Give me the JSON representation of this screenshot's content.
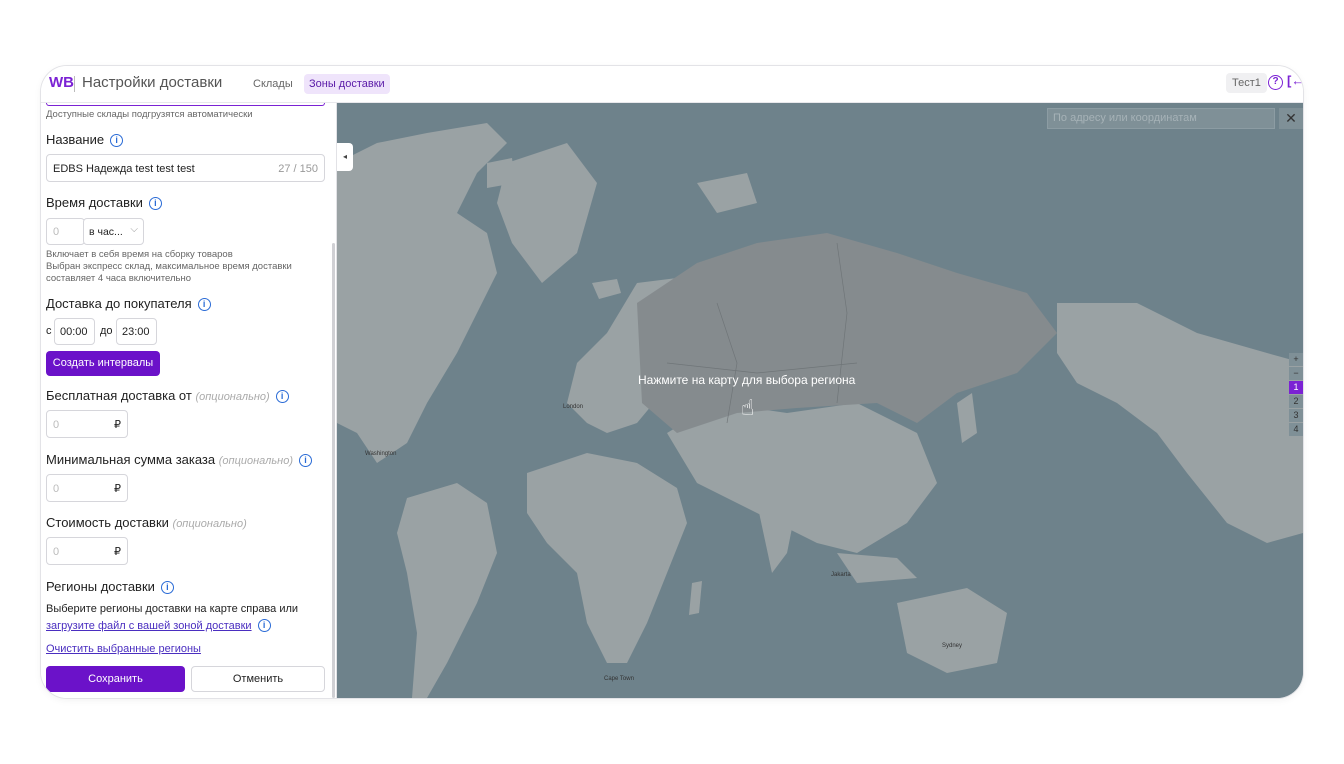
{
  "header": {
    "logo": "WB",
    "title": "Настройки доставки",
    "tabs": [
      {
        "label": "Склады",
        "active": false
      },
      {
        "label": "Зоны доставки",
        "active": true
      }
    ],
    "user": "Тест1",
    "help_icon": "?",
    "logout_icon": "[←"
  },
  "sidebar": {
    "warehouses_hint": "Доступные склады подгрузятся автоматически",
    "name_label": "Название",
    "name_value": "EDBS Надежда test test test",
    "name_counter": "27 / 150",
    "delivery_time_label": "Время доставки",
    "delivery_time_placeholder": "0",
    "delivery_time_unit": "в час...",
    "delivery_time_hint_1": "Включает в себя время на сборку товаров",
    "delivery_time_hint_2": "Выбран экспресс склад, максимальное время доставки",
    "delivery_time_hint_3": "составляет 4 часа включительно",
    "to_customer_label": "Доставка до покупателя",
    "from_prefix": "с",
    "from_value": "00:00",
    "to_prefix": "до",
    "to_value": "23:00",
    "create_intervals_button": "Создать интервалы",
    "free_delivery_label": "Бесплатная доставка от",
    "optional": "(опционально)",
    "min_order_label": "Минимальная сумма заказа",
    "delivery_cost_label": "Стоимость доставки",
    "money_placeholder": "0",
    "currency": "₽",
    "regions_label": "Регионы доставки",
    "regions_text": "Выберите регионы доставки на карте справа или",
    "upload_link": "загрузите файл с вашей зоной доставки",
    "clear_link": "Очистить выбранные регионы",
    "save_button": "Сохранить",
    "cancel_button": "Отменить"
  },
  "map": {
    "search_placeholder": "По адресу или координатам",
    "close": "✕",
    "collapse": "◂",
    "hint": "Нажмите на карту для выбора региона",
    "zoom_levels": [
      "+",
      "−",
      "1",
      "2",
      "3",
      "4"
    ],
    "active_level": "1",
    "cities": [
      "Washington",
      "London",
      "Cape Town",
      "Jakarta",
      "Sydney"
    ],
    "colors": {
      "water": "#6e828b",
      "land": "#9aa2a4",
      "russia": "#858b8e",
      "accent": "#7b22d4"
    }
  }
}
